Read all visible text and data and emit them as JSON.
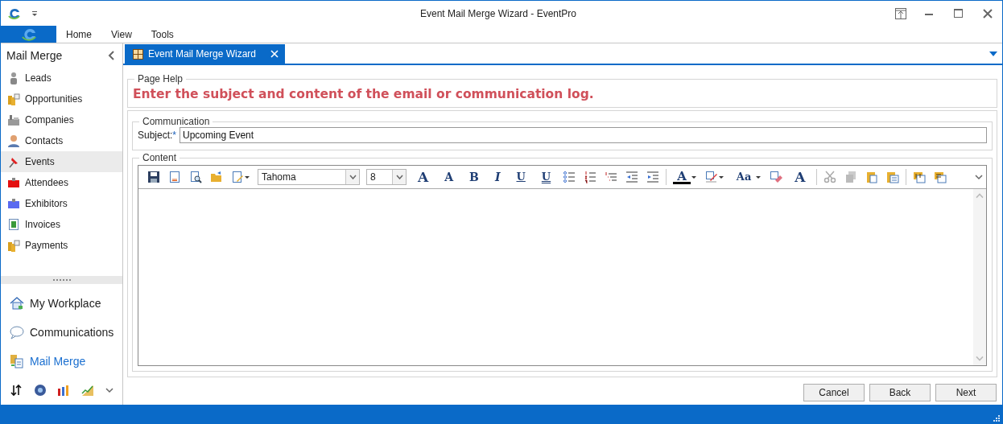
{
  "window": {
    "title": "Event Mail Merge Wizard - EventPro"
  },
  "ribbon_tabs": [
    {
      "label": "Home"
    },
    {
      "label": "View"
    },
    {
      "label": "Tools"
    }
  ],
  "sidebar": {
    "title": "Mail Merge",
    "items": [
      {
        "label": "Leads",
        "selected": false
      },
      {
        "label": "Opportunities",
        "selected": false
      },
      {
        "label": "Companies",
        "selected": false
      },
      {
        "label": "Contacts",
        "selected": false
      },
      {
        "label": "Events",
        "selected": true
      },
      {
        "label": "Attendees",
        "selected": false
      },
      {
        "label": "Exhibitors",
        "selected": false
      },
      {
        "label": "Invoices",
        "selected": false
      },
      {
        "label": "Payments",
        "selected": false
      }
    ],
    "nav_groups": [
      {
        "label": "My Workplace",
        "selected": false
      },
      {
        "label": "Communications",
        "selected": false
      },
      {
        "label": "Mail Merge",
        "selected": true
      }
    ]
  },
  "document_tabs": [
    {
      "label": "Event Mail Merge Wizard",
      "selected": true
    }
  ],
  "page_help": {
    "title": "Page Help",
    "text": "Enter the subject and content of the email or communication log."
  },
  "communication": {
    "title": "Communication",
    "subject_label": "Subject:",
    "required_mark": "*",
    "subject_value": "Upcoming Event"
  },
  "content": {
    "title": "Content",
    "font": "Tahoma",
    "font_size": "8",
    "toolbar_letters": [
      "A",
      "A",
      "B",
      "I",
      "U",
      "U",
      "A",
      "Aa",
      "A"
    ]
  },
  "buttons": [
    {
      "label": "Cancel"
    },
    {
      "label": "Back"
    },
    {
      "label": "Next"
    }
  ]
}
